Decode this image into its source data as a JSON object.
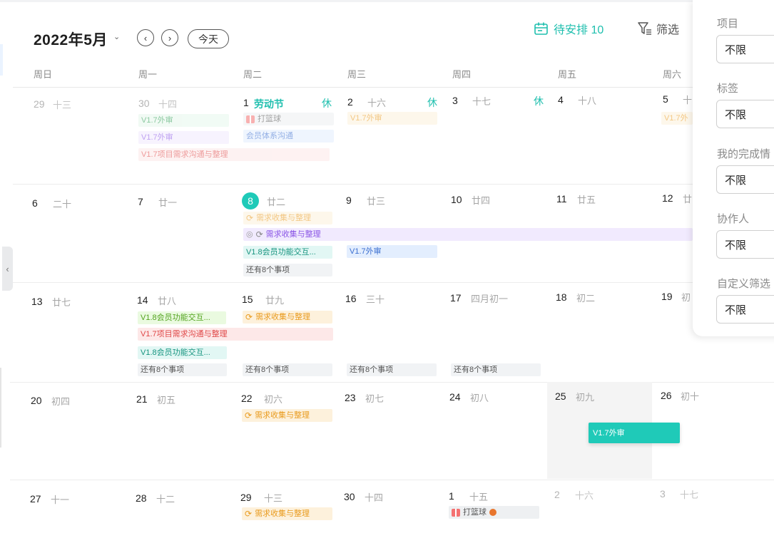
{
  "toolbar": {
    "month_title": "2022年5月",
    "month_caret": "⌄",
    "prev_icon": "‹",
    "next_icon": "›",
    "today_label": "今天",
    "pending_label": "待安排 10",
    "filter_label": "筛选"
  },
  "weekdays": [
    "周日",
    "周一",
    "周二",
    "周三",
    "周四",
    "周五",
    "周六"
  ],
  "weeks": [
    {
      "days": [
        {
          "num": "29",
          "lunar": "十三",
          "dim": true
        },
        {
          "num": "30",
          "lunar": "十四",
          "dim": true
        },
        {
          "num": "1",
          "lunar": "",
          "holiday": "劳动节",
          "off": "休"
        },
        {
          "num": "2",
          "lunar": "十六",
          "off": "休"
        },
        {
          "num": "3",
          "lunar": "十七",
          "off": "休"
        },
        {
          "num": "4",
          "lunar": "十八"
        },
        {
          "num": "5",
          "lunar": "十"
        }
      ]
    },
    {
      "days": [
        {
          "num": "6",
          "lunar": "二十"
        },
        {
          "num": "7",
          "lunar": "廿一"
        },
        {
          "num": "8",
          "lunar": "廿二",
          "today": true
        },
        {
          "num": "9",
          "lunar": "廿三"
        },
        {
          "num": "10",
          "lunar": "廿四"
        },
        {
          "num": "11",
          "lunar": "廿五"
        },
        {
          "num": "12",
          "lunar": "廿"
        }
      ]
    },
    {
      "days": [
        {
          "num": "13",
          "lunar": "廿七"
        },
        {
          "num": "14",
          "lunar": "廿八"
        },
        {
          "num": "15",
          "lunar": "廿九"
        },
        {
          "num": "16",
          "lunar": "三十"
        },
        {
          "num": "17",
          "lunar": "四月初一"
        },
        {
          "num": "18",
          "lunar": "初二"
        },
        {
          "num": "19",
          "lunar": "初"
        }
      ]
    },
    {
      "days": [
        {
          "num": "20",
          "lunar": "初四"
        },
        {
          "num": "21",
          "lunar": "初五"
        },
        {
          "num": "22",
          "lunar": "初六"
        },
        {
          "num": "23",
          "lunar": "初七"
        },
        {
          "num": "24",
          "lunar": "初八"
        },
        {
          "num": "25",
          "lunar": "初九"
        },
        {
          "num": "26",
          "lunar": "初十"
        }
      ]
    },
    {
      "days": [
        {
          "num": "27",
          "lunar": "十一"
        },
        {
          "num": "28",
          "lunar": "十二"
        },
        {
          "num": "29",
          "lunar": "十三"
        },
        {
          "num": "30",
          "lunar": "十四"
        },
        {
          "num": "1",
          "lunar": "十五"
        },
        {
          "num": "2",
          "lunar": "十六",
          "dim": true
        },
        {
          "num": "3",
          "lunar": "十七",
          "dim": true
        }
      ]
    }
  ],
  "events": {
    "w1_v17_review_a": "V1.7外审",
    "w1_v17_review_b": "V1.7外审",
    "w1_v17_req_comm": "V1.7项目需求沟通与整理",
    "w1_basketball": "打篮球",
    "w1_member_comm": "会员体系沟通",
    "w1_v17_review_c": "V1.7外审",
    "w1_v17_review_d": "V1.7外",
    "w2_req_collect_a": "需求收集与整理",
    "w2_req_collect_span": "需求收集与整理",
    "w2_v18_member": "V1.8会员功能交互...",
    "w2_v17_review": "V1.7外审",
    "w2_more": "还有8个事项",
    "w3_v18_member_a": "V1.8会员功能交互...",
    "w3_req_collect": "需求收集与整理",
    "w3_v17_req_comm": "V1.7项目需求沟通与整理",
    "w3_v18_member_b": "V1.8会员功能交互...",
    "w3_more_mon": "还有8个事项",
    "w3_more_tue": "还有8个事项",
    "w3_more_wed": "还有8个事项",
    "w3_more_thu": "还有8个事项",
    "w4_req_collect": "需求收集与整理",
    "w4_v17_review_drag": "V1.7外审",
    "w5_req_collect": "需求收集与整理",
    "w5_basketball": "打篮球"
  },
  "filter_panel": {
    "project_label": "项目",
    "project_value": "不限",
    "tag_label": "标签",
    "tag_value": "不限",
    "completion_label": "我的完成情",
    "completion_value": "不限",
    "collaborator_label": "协作人",
    "collaborator_value": "不限",
    "custom_label": "自定义筛选",
    "custom_value": "不限"
  },
  "collapse_icon": "‹",
  "colors": {
    "accent": "#1fcab8",
    "accent_text": "#1fbfae",
    "holiday": "#1fbfae"
  },
  "icons": [
    "calendar-pending-icon",
    "filter-icon",
    "gift-icon",
    "basketball-icon",
    "repeat-icon",
    "hidden-eye-icon",
    "chevron-left-icon",
    "chevron-right-icon",
    "caret-down-icon"
  ]
}
